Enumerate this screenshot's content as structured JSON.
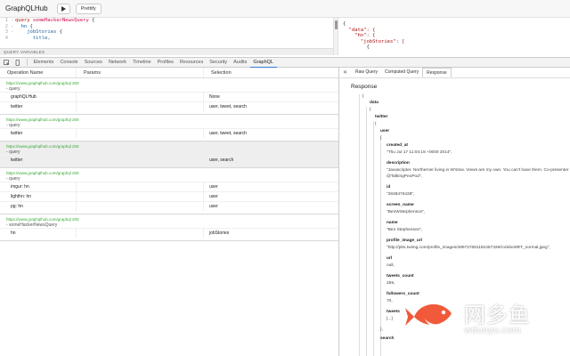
{
  "app": {
    "title": "GraphQLHub"
  },
  "toolbar": {
    "prettify_label": "Prettify",
    "play_icon": "play-icon"
  },
  "editor": {
    "lines": [
      {
        "num": "1",
        "fold": "-",
        "parts": [
          {
            "t": "query ",
            "c": "kw"
          },
          {
            "t": "someHackerNewsQuery",
            "c": "fn"
          },
          {
            "t": " {",
            "c": ""
          }
        ]
      },
      {
        "num": "2",
        "fold": "-",
        "parts": [
          {
            "t": "  ",
            "c": ""
          },
          {
            "t": "hn",
            "c": "field"
          },
          {
            "t": " {",
            "c": ""
          }
        ]
      },
      {
        "num": "3",
        "fold": "-",
        "parts": [
          {
            "t": "    ",
            "c": ""
          },
          {
            "t": "jobStories",
            "c": "field"
          },
          {
            "t": " {",
            "c": ""
          }
        ]
      },
      {
        "num": "4",
        "fold": "",
        "parts": [
          {
            "t": "      ",
            "c": ""
          },
          {
            "t": "title,",
            "c": "field"
          }
        ]
      }
    ],
    "variables_label": "QUERY VARIABLES"
  },
  "result_preview": {
    "lines": [
      {
        "text": "{",
        "c": ""
      },
      {
        "text": "  \"data\": {",
        "c": "str"
      },
      {
        "text": "    \"hn\": {",
        "c": "str"
      },
      {
        "text": "      \"jobStories\": [",
        "c": "str"
      },
      {
        "text": "        {",
        "c": ""
      }
    ]
  },
  "devtools": {
    "tabs": [
      "Elements",
      "Console",
      "Sources",
      "Network",
      "Timeline",
      "Profiles",
      "Resources",
      "Security",
      "Audits",
      "GraphQL"
    ],
    "active_tab": "GraphQL"
  },
  "table": {
    "headers": {
      "operation": "Operation Name",
      "params": "Params",
      "selection": "Selection"
    },
    "groups": [
      {
        "url": "https://www.graphqlhub.com/graphql 200",
        "kind": "- query",
        "selected": false,
        "rows": [
          {
            "op": "graphQLHub",
            "params": "",
            "sel": "None"
          },
          {
            "op": "twitter",
            "params": "",
            "sel": "user, tweet, search"
          }
        ]
      },
      {
        "url": "https://www.graphqlhub.com/graphql 200",
        "kind": "- query",
        "selected": false,
        "rows": [
          {
            "op": "twitter",
            "params": "",
            "sel": "user, tweet, search"
          }
        ]
      },
      {
        "url": "https://www.graphqlhub.com/graphql 200",
        "kind": "- query",
        "selected": true,
        "rows": [
          {
            "op": "twitter",
            "params": "",
            "sel": "user, search"
          }
        ]
      },
      {
        "url": "https://www.graphqlhub.com/graphql 200",
        "kind": "- query",
        "selected": false,
        "rows": [
          {
            "op": "imgur: hn",
            "params": "",
            "sel": "user"
          },
          {
            "op": "lighthn: hn",
            "params": "",
            "sel": "user"
          },
          {
            "op": "pg: hn",
            "params": "",
            "sel": "user"
          }
        ]
      },
      {
        "url": "https://www.graphqlhub.com/graphql 200",
        "kind": "- someHackerNewsQuery",
        "selected": false,
        "rows": [
          {
            "op": "hn",
            "params": "",
            "sel": "jobStories"
          }
        ]
      }
    ]
  },
  "response": {
    "tabs": [
      "Raw Query",
      "Computed Query",
      "Response"
    ],
    "active_tab": "Response",
    "title": "Response",
    "tree": {
      "open_bracket": "{",
      "data_key": "data",
      "data_open": "{",
      "twitter_key": "twitter",
      "twitter_open": "{",
      "user_key": "user",
      "user_open": "{",
      "created_at_key": "created_at",
      "created_at_val": "\"Thu Jul 17 11:04:18 +0000 2014\",",
      "description_key": "description",
      "description_val1": "\"Javascripter. Northerner living in W'stow. Views are my own. You can't have them. Co-presenter",
      "description_val2": "@TalkingPeoPod\",",
      "id_key": "id",
      "id_val": "\"2638476438\",",
      "screen_name_key": "screen_name",
      "screen_name_val": "\"BenWStephenson\",",
      "name_key": "name",
      "name_val": "\"Ben Stephenson\",",
      "profile_image_key": "profile_image_url",
      "profile_image_val": "\"http://pbs.twimg.com/profile_images/489727681182457328/ronklxn8RT_normal.jpeg\",",
      "url_key": "url",
      "url_val": "null,",
      "tweets_count_key": "tweets_count",
      "tweets_count_val": "259,",
      "followers_count_key": "followers_count",
      "followers_count_val": "70,",
      "tweets_key": "tweets",
      "tweets_val": "[...]",
      "close_brace": "},",
      "search_key": "search"
    }
  },
  "watermark": {
    "cn": "网多鱼",
    "url": "wduoyu.com",
    "fish_color": "#f05a3a"
  }
}
